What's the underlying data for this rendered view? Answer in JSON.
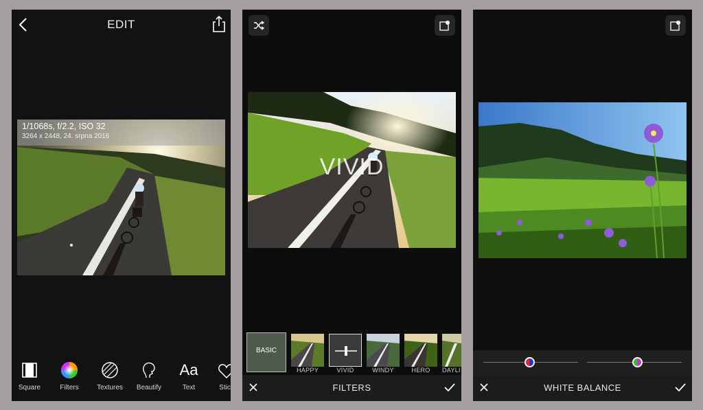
{
  "screen1": {
    "title": "EDIT",
    "exif_line1": "1/1068s, f/2.2, ISO 32",
    "exif_line2": "3264 x 2448, 24. srpna 2016",
    "tools": [
      {
        "label": "Square",
        "icon": "square-icon"
      },
      {
        "label": "Filters",
        "icon": "color-wheel-icon"
      },
      {
        "label": "Textures",
        "icon": "textures-icon"
      },
      {
        "label": "Beautify",
        "icon": "face-icon"
      },
      {
        "label": "Text",
        "icon": "text-aa-icon"
      },
      {
        "label": "Stick",
        "icon": "sticker-icon"
      }
    ]
  },
  "screen2": {
    "overlay": "VIVID",
    "filters": [
      {
        "label": "BASIC"
      },
      {
        "label": "HAPPY"
      },
      {
        "label": "VIVID"
      },
      {
        "label": "WINDY"
      },
      {
        "label": "HERO"
      },
      {
        "label": "DAYLI"
      }
    ],
    "bottom_title": "FILTERS"
  },
  "screen3": {
    "bottom_title": "WHITE BALANCE",
    "slider1_value": 0.5,
    "slider2_value": 0.5
  }
}
